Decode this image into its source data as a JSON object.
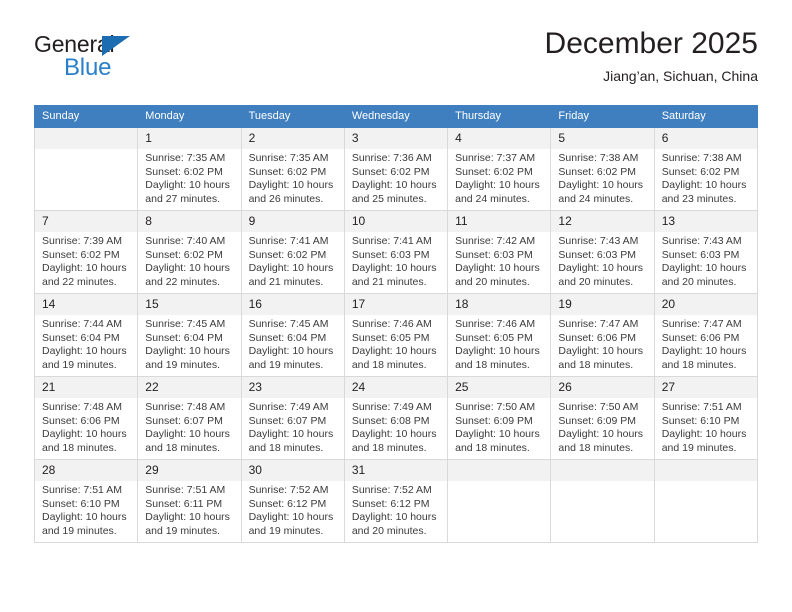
{
  "brand": {
    "name_top": "General",
    "name_bottom": "Blue",
    "triangle_color": "#1b6cb0",
    "blue_color": "#2a7fc9"
  },
  "header": {
    "title": "December 2025",
    "location": "Jiang’an, Sichuan, China"
  },
  "theme": {
    "header_row_bg": "#3f7fbf",
    "header_row_text": "#ffffff",
    "daynum_bg": "#f2f2f2",
    "grid_border": "#d9d9d9",
    "text": "#231f20"
  },
  "calendar": {
    "weekdays": [
      "Sunday",
      "Monday",
      "Tuesday",
      "Wednesday",
      "Thursday",
      "Friday",
      "Saturday"
    ],
    "weeks": [
      [
        {
          "day": "",
          "lines": []
        },
        {
          "day": "1",
          "lines": [
            "Sunrise: 7:35 AM",
            "Sunset: 6:02 PM",
            "Daylight: 10 hours and 27 minutes."
          ]
        },
        {
          "day": "2",
          "lines": [
            "Sunrise: 7:35 AM",
            "Sunset: 6:02 PM",
            "Daylight: 10 hours and 26 minutes."
          ]
        },
        {
          "day": "3",
          "lines": [
            "Sunrise: 7:36 AM",
            "Sunset: 6:02 PM",
            "Daylight: 10 hours and 25 minutes."
          ]
        },
        {
          "day": "4",
          "lines": [
            "Sunrise: 7:37 AM",
            "Sunset: 6:02 PM",
            "Daylight: 10 hours and 24 minutes."
          ]
        },
        {
          "day": "5",
          "lines": [
            "Sunrise: 7:38 AM",
            "Sunset: 6:02 PM",
            "Daylight: 10 hours and 24 minutes."
          ]
        },
        {
          "day": "6",
          "lines": [
            "Sunrise: 7:38 AM",
            "Sunset: 6:02 PM",
            "Daylight: 10 hours and 23 minutes."
          ]
        }
      ],
      [
        {
          "day": "7",
          "lines": [
            "Sunrise: 7:39 AM",
            "Sunset: 6:02 PM",
            "Daylight: 10 hours and 22 minutes."
          ]
        },
        {
          "day": "8",
          "lines": [
            "Sunrise: 7:40 AM",
            "Sunset: 6:02 PM",
            "Daylight: 10 hours and 22 minutes."
          ]
        },
        {
          "day": "9",
          "lines": [
            "Sunrise: 7:41 AM",
            "Sunset: 6:02 PM",
            "Daylight: 10 hours and 21 minutes."
          ]
        },
        {
          "day": "10",
          "lines": [
            "Sunrise: 7:41 AM",
            "Sunset: 6:03 PM",
            "Daylight: 10 hours and 21 minutes."
          ]
        },
        {
          "day": "11",
          "lines": [
            "Sunrise: 7:42 AM",
            "Sunset: 6:03 PM",
            "Daylight: 10 hours and 20 minutes."
          ]
        },
        {
          "day": "12",
          "lines": [
            "Sunrise: 7:43 AM",
            "Sunset: 6:03 PM",
            "Daylight: 10 hours and 20 minutes."
          ]
        },
        {
          "day": "13",
          "lines": [
            "Sunrise: 7:43 AM",
            "Sunset: 6:03 PM",
            "Daylight: 10 hours and 20 minutes."
          ]
        }
      ],
      [
        {
          "day": "14",
          "lines": [
            "Sunrise: 7:44 AM",
            "Sunset: 6:04 PM",
            "Daylight: 10 hours and 19 minutes."
          ]
        },
        {
          "day": "15",
          "lines": [
            "Sunrise: 7:45 AM",
            "Sunset: 6:04 PM",
            "Daylight: 10 hours and 19 minutes."
          ]
        },
        {
          "day": "16",
          "lines": [
            "Sunrise: 7:45 AM",
            "Sunset: 6:04 PM",
            "Daylight: 10 hours and 19 minutes."
          ]
        },
        {
          "day": "17",
          "lines": [
            "Sunrise: 7:46 AM",
            "Sunset: 6:05 PM",
            "Daylight: 10 hours and 18 minutes."
          ]
        },
        {
          "day": "18",
          "lines": [
            "Sunrise: 7:46 AM",
            "Sunset: 6:05 PM",
            "Daylight: 10 hours and 18 minutes."
          ]
        },
        {
          "day": "19",
          "lines": [
            "Sunrise: 7:47 AM",
            "Sunset: 6:06 PM",
            "Daylight: 10 hours and 18 minutes."
          ]
        },
        {
          "day": "20",
          "lines": [
            "Sunrise: 7:47 AM",
            "Sunset: 6:06 PM",
            "Daylight: 10 hours and 18 minutes."
          ]
        }
      ],
      [
        {
          "day": "21",
          "lines": [
            "Sunrise: 7:48 AM",
            "Sunset: 6:06 PM",
            "Daylight: 10 hours and 18 minutes."
          ]
        },
        {
          "day": "22",
          "lines": [
            "Sunrise: 7:48 AM",
            "Sunset: 6:07 PM",
            "Daylight: 10 hours and 18 minutes."
          ]
        },
        {
          "day": "23",
          "lines": [
            "Sunrise: 7:49 AM",
            "Sunset: 6:07 PM",
            "Daylight: 10 hours and 18 minutes."
          ]
        },
        {
          "day": "24",
          "lines": [
            "Sunrise: 7:49 AM",
            "Sunset: 6:08 PM",
            "Daylight: 10 hours and 18 minutes."
          ]
        },
        {
          "day": "25",
          "lines": [
            "Sunrise: 7:50 AM",
            "Sunset: 6:09 PM",
            "Daylight: 10 hours and 18 minutes."
          ]
        },
        {
          "day": "26",
          "lines": [
            "Sunrise: 7:50 AM",
            "Sunset: 6:09 PM",
            "Daylight: 10 hours and 18 minutes."
          ]
        },
        {
          "day": "27",
          "lines": [
            "Sunrise: 7:51 AM",
            "Sunset: 6:10 PM",
            "Daylight: 10 hours and 19 minutes."
          ]
        }
      ],
      [
        {
          "day": "28",
          "lines": [
            "Sunrise: 7:51 AM",
            "Sunset: 6:10 PM",
            "Daylight: 10 hours and 19 minutes."
          ]
        },
        {
          "day": "29",
          "lines": [
            "Sunrise: 7:51 AM",
            "Sunset: 6:11 PM",
            "Daylight: 10 hours and 19 minutes."
          ]
        },
        {
          "day": "30",
          "lines": [
            "Sunrise: 7:52 AM",
            "Sunset: 6:12 PM",
            "Daylight: 10 hours and 19 minutes."
          ]
        },
        {
          "day": "31",
          "lines": [
            "Sunrise: 7:52 AM",
            "Sunset: 6:12 PM",
            "Daylight: 10 hours and 20 minutes."
          ]
        },
        {
          "day": "",
          "lines": []
        },
        {
          "day": "",
          "lines": []
        },
        {
          "day": "",
          "lines": []
        }
      ]
    ]
  }
}
